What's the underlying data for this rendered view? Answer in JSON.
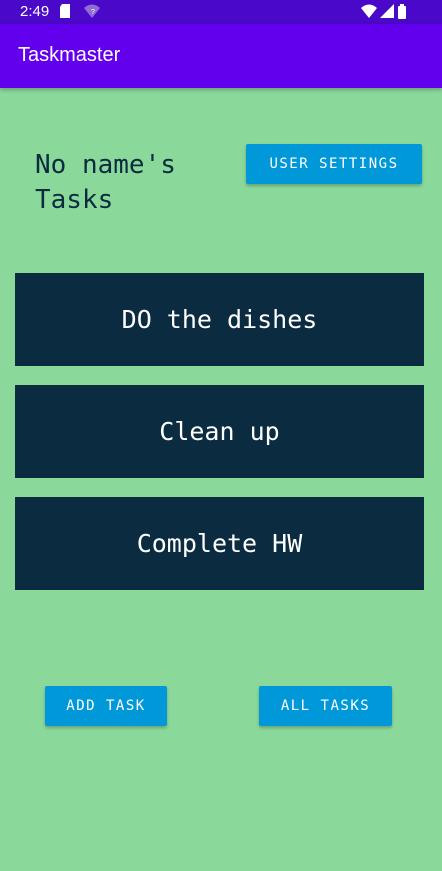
{
  "status_bar": {
    "time": "2:49",
    "icons": [
      "sd-card-icon",
      "wifi-question-icon",
      "wifi-icon",
      "signal-icon",
      "battery-icon"
    ],
    "color": "#4a08c9"
  },
  "app_bar": {
    "title": "Taskmaster",
    "color": "#6200ee"
  },
  "header": {
    "title": "No name's Tasks",
    "user_settings_label": "USER SETTINGS"
  },
  "tasks": [
    {
      "label": "DO the dishes"
    },
    {
      "label": "Clean up"
    },
    {
      "label": "Complete HW"
    }
  ],
  "footer": {
    "add_task_label": "ADD TASK",
    "all_tasks_label": "ALL TASKS"
  },
  "colors": {
    "background": "#8ad99a",
    "task_background": "#0a2b40",
    "button": "#0098d8"
  }
}
